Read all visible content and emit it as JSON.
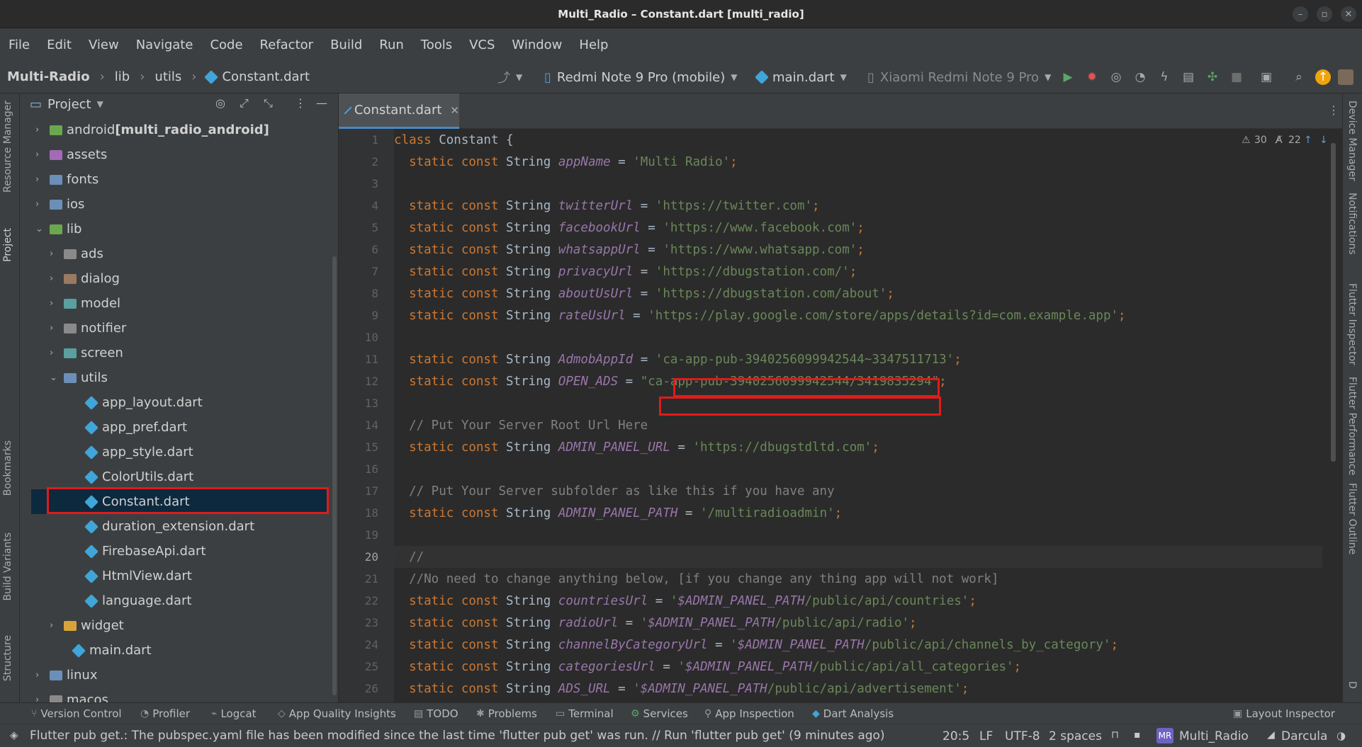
{
  "window": {
    "title": "Multi_Radio – Constant.dart [multi_radio]"
  },
  "menu": [
    "File",
    "Edit",
    "View",
    "Navigate",
    "Code",
    "Refactor",
    "Build",
    "Run",
    "Tools",
    "VCS",
    "Window",
    "Help"
  ],
  "breadcrumb": {
    "project": "Multi-Radio",
    "lib": "lib",
    "utils": "utils",
    "file": "Constant.dart"
  },
  "toolbar": {
    "device_target": "Redmi Note 9 Pro (mobile)",
    "run_config": "main.dart",
    "device_selector": "Xiaomi Redmi Note 9 Pro"
  },
  "project_panel": {
    "title": "Project",
    "items": [
      {
        "label": "android ",
        "bold": "[multi_radio_android]"
      },
      {
        "label": "assets"
      },
      {
        "label": "fonts"
      },
      {
        "label": "ios"
      },
      {
        "label": "lib"
      },
      {
        "label": "ads"
      },
      {
        "label": "dialog"
      },
      {
        "label": "model"
      },
      {
        "label": "notifier"
      },
      {
        "label": "screen"
      },
      {
        "label": "utils"
      },
      {
        "label": "app_layout.dart"
      },
      {
        "label": "app_pref.dart"
      },
      {
        "label": "app_style.dart"
      },
      {
        "label": "ColorUtils.dart"
      },
      {
        "label": "Constant.dart"
      },
      {
        "label": "duration_extension.dart"
      },
      {
        "label": "FirebaseApi.dart"
      },
      {
        "label": "HtmlView.dart"
      },
      {
        "label": "language.dart"
      },
      {
        "label": "widget"
      },
      {
        "label": "main.dart"
      },
      {
        "label": "linux"
      },
      {
        "label": "macos"
      }
    ]
  },
  "editor": {
    "tab": "Constant.dart",
    "warnings": "30",
    "weak_warnings": "22",
    "current_line": 20,
    "lines": [
      {
        "n": "1",
        "code": [
          [
            "kw",
            "class "
          ],
          [
            "plain",
            "Constant {"
          ]
        ]
      },
      {
        "n": "2",
        "code": [
          [
            "kw",
            "  static const "
          ],
          [
            "plain",
            "String "
          ],
          [
            "id",
            "appName"
          ],
          [
            "plain",
            " = "
          ],
          [
            "str",
            "'Multi Radio'"
          ],
          [
            "kw",
            ";"
          ]
        ]
      },
      {
        "n": "3",
        "code": []
      },
      {
        "n": "4",
        "code": [
          [
            "kw",
            "  static const "
          ],
          [
            "plain",
            "String "
          ],
          [
            "id",
            "twitterUrl"
          ],
          [
            "plain",
            " = "
          ],
          [
            "str",
            "'https://twitter.com'"
          ],
          [
            "kw",
            ";"
          ]
        ]
      },
      {
        "n": "5",
        "code": [
          [
            "kw",
            "  static const "
          ],
          [
            "plain",
            "String "
          ],
          [
            "id",
            "facebookUrl"
          ],
          [
            "plain",
            " = "
          ],
          [
            "str",
            "'https://www.facebook.com'"
          ],
          [
            "kw",
            ";"
          ]
        ]
      },
      {
        "n": "6",
        "code": [
          [
            "kw",
            "  static const "
          ],
          [
            "plain",
            "String "
          ],
          [
            "id",
            "whatsappUrl"
          ],
          [
            "plain",
            " = "
          ],
          [
            "str",
            "'https://www.whatsapp.com'"
          ],
          [
            "kw",
            ";"
          ]
        ]
      },
      {
        "n": "7",
        "code": [
          [
            "kw",
            "  static const "
          ],
          [
            "plain",
            "String "
          ],
          [
            "id",
            "privacyUrl"
          ],
          [
            "plain",
            " = "
          ],
          [
            "str",
            "'https://dbugstation.com/'"
          ],
          [
            "kw",
            ";"
          ]
        ]
      },
      {
        "n": "8",
        "code": [
          [
            "kw",
            "  static const "
          ],
          [
            "plain",
            "String "
          ],
          [
            "id",
            "aboutUsUrl"
          ],
          [
            "plain",
            " = "
          ],
          [
            "str",
            "'https://dbugstation.com/about'"
          ],
          [
            "kw",
            ";"
          ]
        ]
      },
      {
        "n": "9",
        "code": [
          [
            "kw",
            "  static const "
          ],
          [
            "plain",
            "String "
          ],
          [
            "id",
            "rateUsUrl"
          ],
          [
            "plain",
            " = "
          ],
          [
            "str",
            "'https://play.google.com/store/apps/details?id=com.example.app'"
          ],
          [
            "kw",
            ";"
          ]
        ]
      },
      {
        "n": "10",
        "code": []
      },
      {
        "n": "11",
        "code": [
          [
            "kw",
            "  static const "
          ],
          [
            "plain",
            "String "
          ],
          [
            "id",
            "AdmobAppId"
          ],
          [
            "plain",
            " = "
          ],
          [
            "str",
            "'ca-app-pub-3940256099942544~3347511713'"
          ],
          [
            "kw",
            ";"
          ]
        ]
      },
      {
        "n": "12",
        "code": [
          [
            "kw",
            "  static const "
          ],
          [
            "plain",
            "String "
          ],
          [
            "id",
            "OPEN_ADS"
          ],
          [
            "plain",
            " = "
          ],
          [
            "str",
            "\"ca-app-pub-3940256099942544/3419835294\""
          ],
          [
            "kw",
            ";"
          ]
        ]
      },
      {
        "n": "13",
        "code": []
      },
      {
        "n": "14",
        "code": [
          [
            "cmt",
            "  // Put Your Server Root Url Here"
          ]
        ]
      },
      {
        "n": "15",
        "code": [
          [
            "kw",
            "  static const "
          ],
          [
            "plain",
            "String "
          ],
          [
            "id",
            "ADMIN_PANEL_URL"
          ],
          [
            "plain",
            " = "
          ],
          [
            "str",
            "'https://dbugstdltd.com'"
          ],
          [
            "kw",
            ";"
          ]
        ]
      },
      {
        "n": "16",
        "code": []
      },
      {
        "n": "17",
        "code": [
          [
            "cmt",
            "  // Put Your Server subfolder as like this if you have any"
          ]
        ]
      },
      {
        "n": "18",
        "code": [
          [
            "kw",
            "  static const "
          ],
          [
            "plain",
            "String "
          ],
          [
            "id",
            "ADMIN_PANEL_PATH"
          ],
          [
            "plain",
            " = "
          ],
          [
            "str",
            "'/multiradioadmin'"
          ],
          [
            "kw",
            ";"
          ]
        ]
      },
      {
        "n": "19",
        "code": []
      },
      {
        "n": "20",
        "code": [
          [
            "cmt",
            "  //"
          ]
        ]
      },
      {
        "n": "21",
        "code": [
          [
            "cmt",
            "  //No need to change anything below, [if you change any thing app will not work]"
          ]
        ]
      },
      {
        "n": "22",
        "code": [
          [
            "kw",
            "  static const "
          ],
          [
            "plain",
            "String "
          ],
          [
            "id",
            "countriesUrl"
          ],
          [
            "plain",
            " = "
          ],
          [
            "str",
            "'"
          ],
          [
            "interp",
            "$ADMIN_PANEL_PATH"
          ],
          [
            "str",
            "/public/api/countries'"
          ],
          [
            "kw",
            ";"
          ]
        ]
      },
      {
        "n": "23",
        "code": [
          [
            "kw",
            "  static const "
          ],
          [
            "plain",
            "String "
          ],
          [
            "id",
            "radioUrl"
          ],
          [
            "plain",
            " = "
          ],
          [
            "str",
            "'"
          ],
          [
            "interp",
            "$ADMIN_PANEL_PATH"
          ],
          [
            "str",
            "/public/api/radio'"
          ],
          [
            "kw",
            ";"
          ]
        ]
      },
      {
        "n": "24",
        "code": [
          [
            "kw",
            "  static const "
          ],
          [
            "plain",
            "String "
          ],
          [
            "id",
            "channelByCategoryUrl"
          ],
          [
            "plain",
            " = "
          ],
          [
            "str",
            "'"
          ],
          [
            "interp",
            "$ADMIN_PANEL_PATH"
          ],
          [
            "str",
            "/public/api/channels_by_category'"
          ],
          [
            "kw",
            ";"
          ]
        ]
      },
      {
        "n": "25",
        "code": [
          [
            "kw",
            "  static const "
          ],
          [
            "plain",
            "String "
          ],
          [
            "id",
            "categoriesUrl"
          ],
          [
            "plain",
            " = "
          ],
          [
            "str",
            "'"
          ],
          [
            "interp",
            "$ADMIN_PANEL_PATH"
          ],
          [
            "str",
            "/public/api/all_categories'"
          ],
          [
            "kw",
            ";"
          ]
        ]
      },
      {
        "n": "26",
        "code": [
          [
            "kw",
            "  static const "
          ],
          [
            "plain",
            "String "
          ],
          [
            "id",
            "ADS_URL"
          ],
          [
            "plain",
            " = "
          ],
          [
            "str",
            "'"
          ],
          [
            "interp",
            "$ADMIN_PANEL_PATH"
          ],
          [
            "str",
            "/public/api/advertisement'"
          ],
          [
            "kw",
            ";"
          ]
        ]
      }
    ]
  },
  "left_tabs": [
    "Resource Manager",
    "Project",
    "Bookmarks",
    "Build Variants",
    "Structure"
  ],
  "right_tabs": [
    "Device Manager",
    "Notifications",
    "Flutter Inspector",
    "Flutter Performance",
    "Flutter Outline",
    "D"
  ],
  "tool_windows": [
    "Version Control",
    "Profiler",
    "Logcat",
    "App Quality Insights",
    "TODO",
    "Problems",
    "Terminal",
    "Services",
    "App Inspection",
    "Dart Analysis",
    "Layout Inspector"
  ],
  "status": {
    "message": "Flutter pub get.: The pubspec.yaml file has been modified since the last time 'flutter pub get' was run. // Run 'flutter pub get' (9 minutes ago)",
    "position": "20:5",
    "line_sep": "LF",
    "encoding": "UTF-8",
    "indent": "2 spaces",
    "project_badge": "MR",
    "project": "Multi_Radio",
    "theme": "Darcula"
  }
}
